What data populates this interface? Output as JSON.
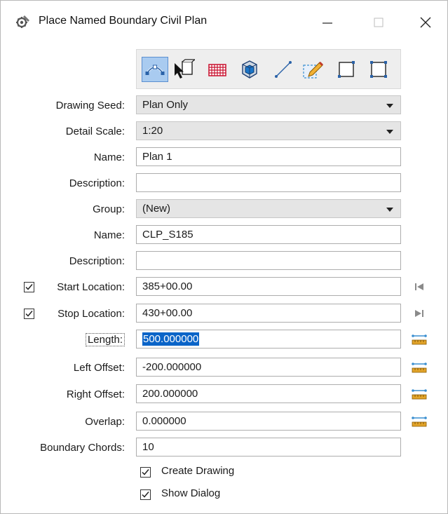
{
  "window": {
    "title": "Place Named Boundary Civil Plan",
    "icon": "gear-wrench-icon",
    "controls": [
      "minimize-icon",
      "maximize-icon",
      "close-icon"
    ]
  },
  "toolbar": {
    "tools": [
      {
        "icon": "civil-plan-tool-icon",
        "active": true
      },
      {
        "icon": "select-element-icon",
        "active": false
      },
      {
        "icon": "grid-tool-icon",
        "active": false
      },
      {
        "icon": "3d-box-tool-icon",
        "active": false
      },
      {
        "icon": "line-tool-icon",
        "active": false
      },
      {
        "icon": "edit-region-icon",
        "active": false
      },
      {
        "icon": "rectangle-tool-icon",
        "active": false
      },
      {
        "icon": "shape-tool-icon",
        "active": false
      }
    ]
  },
  "form": {
    "drawing_seed": {
      "label": "Drawing Seed:",
      "value": "Plan Only"
    },
    "detail_scale": {
      "label": "Detail Scale:",
      "value": "1:20"
    },
    "name1": {
      "label": "Name:",
      "value": "Plan 1"
    },
    "description1": {
      "label": "Description:",
      "value": ""
    },
    "group": {
      "label": "Group:",
      "value": "(New)"
    },
    "name2": {
      "label": "Name:",
      "value": "CLP_S185"
    },
    "description2": {
      "label": "Description:",
      "value": ""
    },
    "start_location": {
      "label": "Start Location:",
      "value": "385+00.00",
      "checked": true
    },
    "stop_location": {
      "label": "Stop Location:",
      "value": "430+00.00",
      "checked": true
    },
    "length": {
      "label": "Length:",
      "value": "500.000000"
    },
    "left_offset": {
      "label": "Left Offset:",
      "value": "-200.000000"
    },
    "right_offset": {
      "label": "Right Offset:",
      "value": "200.000000"
    },
    "overlap": {
      "label": "Overlap:",
      "value": "0.000000"
    },
    "boundary_chords": {
      "label": "Boundary Chords:",
      "value": "10"
    },
    "create_drawing": {
      "label": "Create Drawing",
      "checked": true
    },
    "show_dialog": {
      "label": "Show Dialog",
      "checked": true
    }
  },
  "colors": {
    "selection": "#0a64c8",
    "active_tool": "#a9cbf0",
    "ruler_icon": "#3a8fd0"
  }
}
